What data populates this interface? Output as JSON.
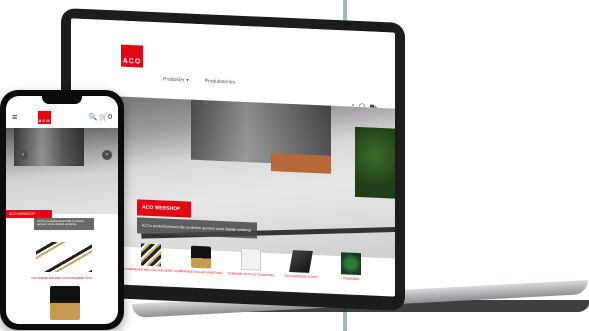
{
  "brand": {
    "logo_text": "ACO",
    "accent_color": "#e30613"
  },
  "laptop": {
    "nav": [
      {
        "label": "Produkter ▾"
      },
      {
        "label": "Produktseries"
      }
    ],
    "icons": [
      "search-icon",
      "user-icon",
      "cart-icon"
    ],
    "hero": {
      "badge": "ACO WEBSHOP",
      "caption": "ACO's produktsortiment fås nu direkte gennem vores digitale webshop"
    },
    "products": [
      {
        "label": "FACADERENDE MED GALVANISERET RIST",
        "thumb": "p1"
      },
      {
        "label": "BRÆNDE I ELLER SANDFANG",
        "thumb": "p2"
      },
      {
        "label": "TILBEHØR TIL PLASTSANDFANG",
        "thumb": "p3"
      },
      {
        "label": "FACADERENDE & RIST",
        "thumb": "p4"
      },
      {
        "label": "TAGBRØND",
        "thumb": "p5"
      }
    ]
  },
  "phone": {
    "menu_icon": "≡",
    "logo_text": "ACO",
    "icons_text": "🔍 🛒0",
    "hero": {
      "badge": "ACO WEBSHOP",
      "caption": "ACO's produktsortiment fås nu direkte gennem vores digitale webshop"
    },
    "product_label": "FACADERENDE MED GALVANISERET RIST",
    "arrows": {
      "left": "‹",
      "right": "›"
    }
  }
}
